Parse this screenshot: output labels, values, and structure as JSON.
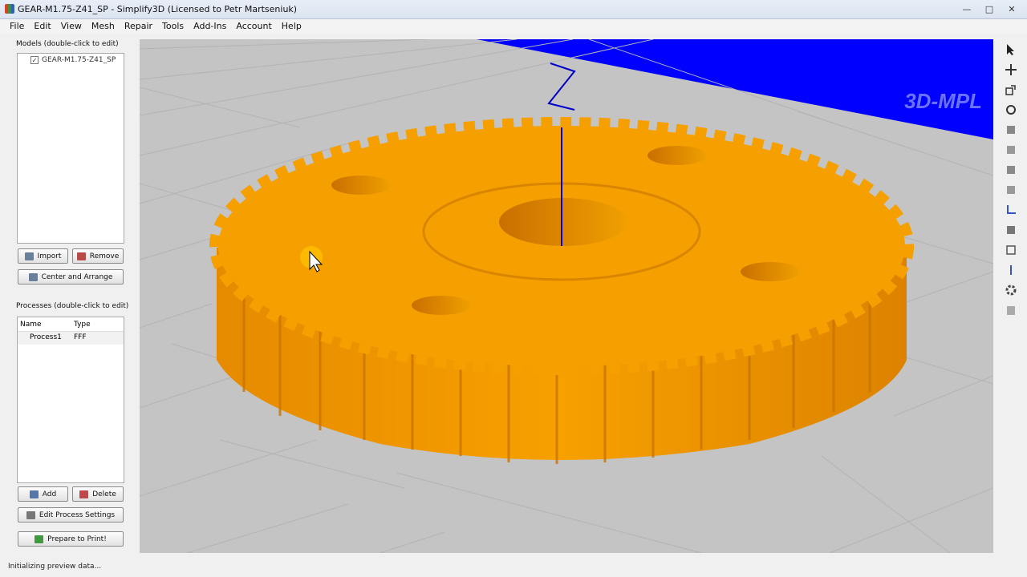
{
  "window": {
    "title": "GEAR-M1.75-Z41_SP - Simplify3D (Licensed to Petr Martseniuk)"
  },
  "menu": [
    "File",
    "Edit",
    "View",
    "Mesh",
    "Repair",
    "Tools",
    "Add-Ins",
    "Account",
    "Help"
  ],
  "models": {
    "label": "Models (double-click to edit)",
    "items": [
      {
        "name": "GEAR-M1.75-Z41_SP",
        "checked": true
      }
    ],
    "import_label": "Import",
    "remove_label": "Remove",
    "center_label": "Center and Arrange"
  },
  "processes": {
    "label": "Processes (double-click to edit)",
    "col_name": "Name",
    "col_type": "Type",
    "rows": [
      {
        "name": "Process1",
        "type": "FFF"
      }
    ],
    "add_label": "Add",
    "delete_label": "Delete",
    "edit_label": "Edit Process Settings",
    "prepare_label": "Prepare to Print!"
  },
  "viewport": {
    "axis_label": "Z",
    "watermark": "3D-MPL",
    "gear_color": "#f59f00",
    "bed_color": "#c5c5c5",
    "wall_color": "#0000ff"
  },
  "toolbar_icons": [
    "select-icon",
    "move-icon",
    "scale-icon",
    "rotate-icon",
    "view-default-icon",
    "view-top-icon",
    "view-front-icon",
    "view-side-icon",
    "axes-icon",
    "perspective-icon",
    "build-volume-icon",
    "cross-section-icon",
    "settings-icon",
    "layers-icon"
  ],
  "status": {
    "text": "Initializing preview data..."
  }
}
